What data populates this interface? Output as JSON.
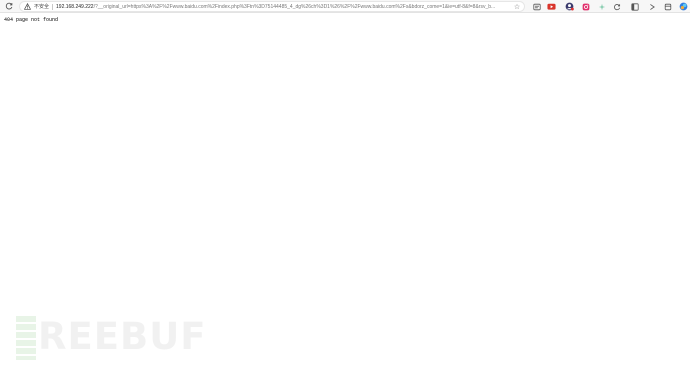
{
  "browser": {
    "reload_icon": "reload-icon",
    "security_label": "不安全",
    "url_host": "192.168.249.222",
    "url_path": "/?__original_url=https%3A%2F%2Fwww.baidu.com%2Findex.php%3Ftn%3D75144485_4_dg%26ch%3D1%26%2F%2Fwww.baidu.com%2Fs&bdorz_come=1&ie=utf-8&f=8&rsv_b...",
    "star_icon": "bookmark-star-icon",
    "extensions": [
      "reader-icon",
      "youtube-ext-icon",
      "account-ext-icon",
      "instagram-ext-icon",
      "puzzle-icon",
      "sparkle-icon",
      "sync-icon",
      "collections-icon",
      "downloads-icon",
      "copilot-icon"
    ],
    "colors": {
      "toolbar_bg": "#f7f7f7",
      "youtube_red": "#d9342b",
      "instagram_pink": "#e1306c",
      "copilot_blue": "#2f7de1"
    }
  },
  "page": {
    "message": "404 page not found"
  },
  "watermark": {
    "text": "REEBUF"
  }
}
